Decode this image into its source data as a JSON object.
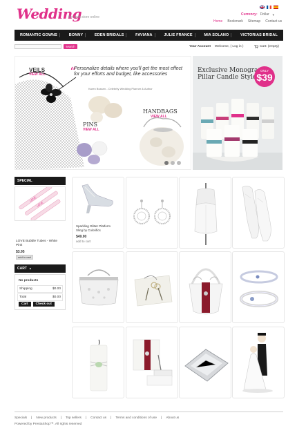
{
  "header": {
    "logo_text": "Wedding",
    "tagline": "the best store online",
    "currency_label": "Currency:",
    "currency_value": "Dollar",
    "links": [
      "Home",
      "Bookmark",
      "Sitemap",
      "Contact us"
    ]
  },
  "nav": {
    "items": [
      "ROMANTIC GOWNS",
      "BONNY",
      "EDEN BRIDALS",
      "FAVIANA",
      "JULIE FRANCE",
      "MIA SOLANO",
      "VICTORIAS BRIDAL"
    ]
  },
  "search": {
    "button_label": "search"
  },
  "account": {
    "label": "Your Account",
    "welcome": "Welcome, ( Log in )",
    "cart": "Cart: (empty)"
  },
  "banner": {
    "veils": "VEILS",
    "veils_link": "VIEW ALL",
    "quote": "Personalize details where you'll get the most effect for your efforts and budget, like accessories",
    "quote_author": "Karen Bussen - Celebrity Wedding Planner & Author",
    "pins": "PINS",
    "pins_link": "VIEW ALL",
    "handbags": "HANDBAGS",
    "handbags_link": "VIEW ALL"
  },
  "promo": {
    "title": "Exclusive Monogram Pillar Candle Style",
    "badge_only": "ONLY",
    "badge_price": "$39"
  },
  "sidebar": {
    "special_title": "SPECIAL",
    "special_name": "LOVE Bubble Tubes - White Pink",
    "special_price": "$3.95",
    "special_button": "add to cart",
    "cart_title": "CART",
    "cart_empty": "No products",
    "shipping_label": "Shipping",
    "shipping_value": "$0.00",
    "total_label": "Total",
    "total_value": "$0.00",
    "cart_button": "Cart",
    "checkout_button": "Check out"
  },
  "products": {
    "featured_name": "Sparkling Glitter Platform Sling by Colorifics",
    "featured_price": "$49.00",
    "featured_button": "add to cart"
  },
  "footer": {
    "links": [
      "Specials",
      "New products",
      "Top sellers",
      "Contact us",
      "Terms and conditions of use",
      "About us"
    ],
    "copyright": "Powered by PrestaShop™. All rights reserved"
  },
  "colors": {
    "accent": "#e0308a",
    "dark": "#1a1a1a"
  }
}
